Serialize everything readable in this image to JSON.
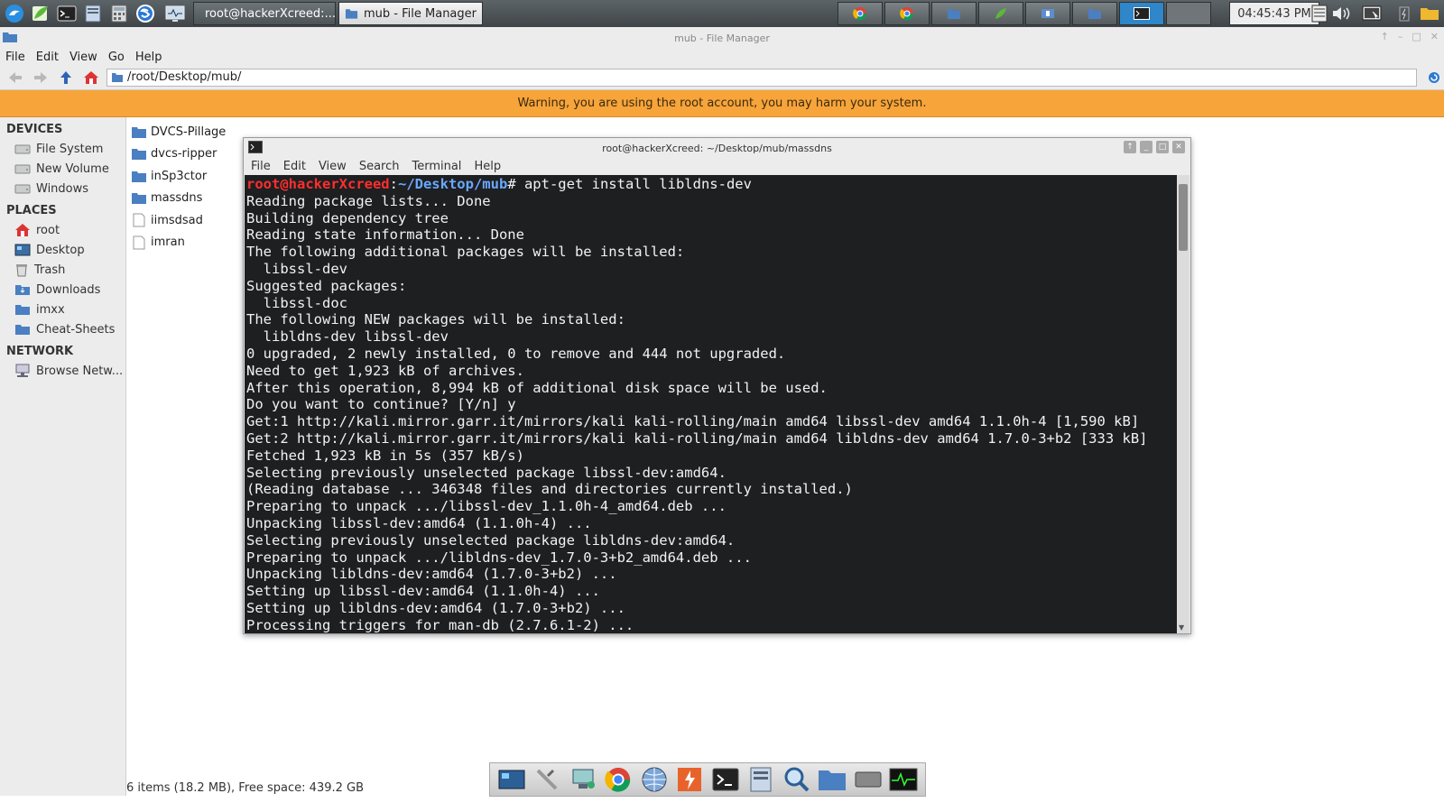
{
  "panel": {
    "launchers": [
      "kali-menu-icon",
      "leafpad-icon",
      "terminal-icon",
      "file-manager-icon",
      "calculator-icon",
      "skype-icon",
      "system-monitor-icon"
    ],
    "tasks": [
      {
        "label": "root@hackerXcreed:..."
      },
      {
        "label": "mub - File Manager"
      }
    ],
    "minitray": [
      "chrome-icon",
      "chrome-icon",
      "folder-icon",
      "leafpad-icon",
      "app-icon",
      "folder-icon",
      "terminal-icon"
    ],
    "clock": "04:45:43 PM"
  },
  "file_manager": {
    "title": "mub - File Manager",
    "menu": [
      "File",
      "Edit",
      "View",
      "Go",
      "Help"
    ],
    "address": "/root/Desktop/mub/",
    "warning": "Warning, you are using the root account, you may harm your system.",
    "sidebar": {
      "devices_heading": "DEVICES",
      "devices": [
        "File System",
        "New Volume",
        "Windows"
      ],
      "places_heading": "PLACES",
      "places": [
        "root",
        "Desktop",
        "Trash",
        "Downloads",
        "imxx",
        "Cheat-Sheets"
      ],
      "network_heading": "NETWORK",
      "network": [
        "Browse Netw..."
      ]
    },
    "files": [
      {
        "name": "DVCS-Pillage",
        "type": "folder"
      },
      {
        "name": "dvcs-ripper",
        "type": "folder"
      },
      {
        "name": "inSp3ctor",
        "type": "folder"
      },
      {
        "name": "massdns",
        "type": "folder"
      },
      {
        "name": "iimsdsad",
        "type": "file"
      },
      {
        "name": "imran",
        "type": "file"
      }
    ],
    "status": "6 items (18.2 MB), Free space: 439.2 GB"
  },
  "terminal": {
    "title": "root@hackerXcreed: ~/Desktop/mub/massdns",
    "menu": [
      "File",
      "Edit",
      "View",
      "Search",
      "Terminal",
      "Help"
    ],
    "prompt_user": "root@hackerXcreed",
    "prompt_colon": ":",
    "prompt_path": "~/Desktop/mub",
    "prompt_cmd": "# apt-get install libldns-dev",
    "lines": [
      "Reading package lists... Done",
      "Building dependency tree",
      "Reading state information... Done",
      "The following additional packages will be installed:",
      "  libssl-dev",
      "Suggested packages:",
      "  libssl-doc",
      "The following NEW packages will be installed:",
      "  libldns-dev libssl-dev",
      "0 upgraded, 2 newly installed, 0 to remove and 444 not upgraded.",
      "Need to get 1,923 kB of archives.",
      "After this operation, 8,994 kB of additional disk space will be used.",
      "Do you want to continue? [Y/n] y",
      "Get:1 http://kali.mirror.garr.it/mirrors/kali kali-rolling/main amd64 libssl-dev amd64 1.1.0h-4 [1,590 kB]",
      "Get:2 http://kali.mirror.garr.it/mirrors/kali kali-rolling/main amd64 libldns-dev amd64 1.7.0-3+b2 [333 kB]",
      "Fetched 1,923 kB in 5s (357 kB/s)",
      "Selecting previously unselected package libssl-dev:amd64.",
      "(Reading database ... 346348 files and directories currently installed.)",
      "Preparing to unpack .../libssl-dev_1.1.0h-4_amd64.deb ...",
      "Unpacking libssl-dev:amd64 (1.1.0h-4) ...",
      "Selecting previously unselected package libldns-dev:amd64.",
      "Preparing to unpack .../libldns-dev_1.7.0-3+b2_amd64.deb ...",
      "Unpacking libldns-dev:amd64 (1.7.0-3+b2) ...",
      "Setting up libssl-dev:amd64 (1.1.0h-4) ...",
      "Setting up libldns-dev:amd64 (1.7.0-3+b2) ...",
      "Processing triggers for man-db (2.7.6.1-2) ..."
    ]
  },
  "dock": [
    "workspace-icon",
    "tools-icon",
    "network-icon",
    "chrome-icon",
    "browser-icon",
    "burpsuite-icon",
    "terminal-icon",
    "files-icon",
    "search-icon",
    "folder-icon",
    "drive-icon",
    "system-monitor-icon"
  ],
  "colors": {
    "warning_bg": "#f7a43a",
    "terminal_bg": "#1d1f21",
    "prompt_user": "#ff2e2e",
    "prompt_path": "#6aa8ff"
  }
}
